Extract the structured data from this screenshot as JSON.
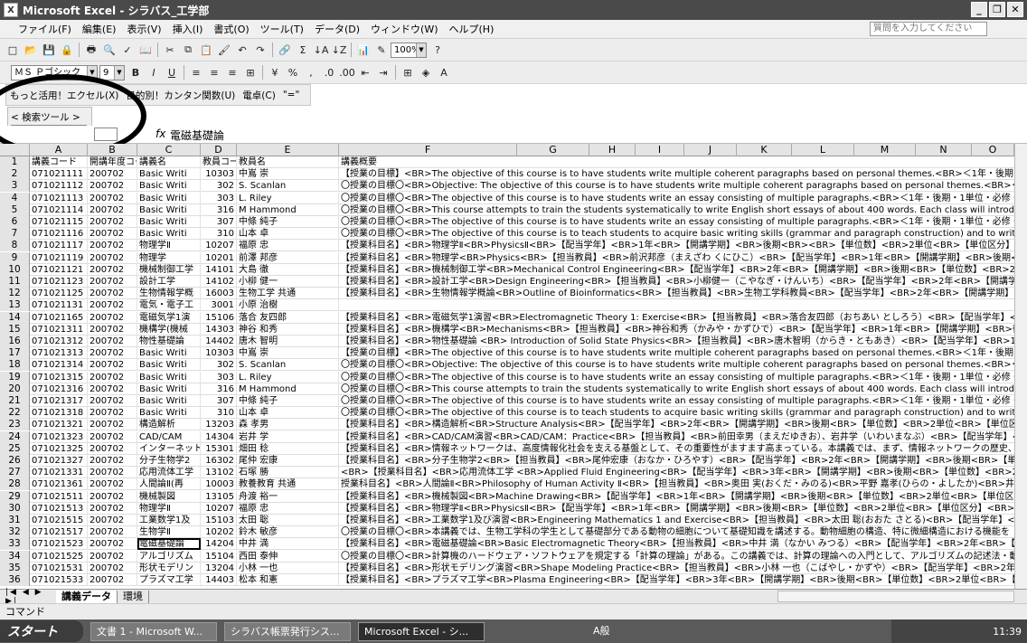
{
  "window": {
    "title": "Microsoft Excel - シラバス_工学部"
  },
  "menu": {
    "items": [
      "ファイル(F)",
      "編集(E)",
      "表示(V)",
      "挿入(I)",
      "書式(O)",
      "ツール(T)",
      "データ(D)",
      "ウィンドウ(W)",
      "ヘルプ(H)"
    ],
    "help_placeholder": "質問を入力してください"
  },
  "toolbar": {
    "zoom": "100%",
    "font": "ＭＳ Ｐゴシック",
    "size": "9"
  },
  "toolbar3": {
    "items": [
      "もっと活用！エクセル(X)",
      "目的別！カンタン関数(U)",
      "電卓(C)",
      "\"=\""
    ]
  },
  "search": {
    "label": "< 検索ツール >",
    "button": "検索"
  },
  "formula": {
    "fx": "fx",
    "value": "電磁基礎論"
  },
  "columns": [
    "A",
    "B",
    "C",
    "D",
    "E",
    "F",
    "G",
    "H",
    "I",
    "J",
    "K",
    "L",
    "M",
    "N",
    "O"
  ],
  "rows": [
    {
      "n": "1",
      "a": "講義コード",
      "b": "開講年度コード",
      "c": "講義名",
      "d": "教員コード",
      "e": "教員名",
      "f": "講義概要"
    },
    {
      "n": "2",
      "a": "071021111",
      "b": "200702",
      "c": "Basic Writi",
      "d": "10303",
      "e": "中嶌 崇",
      "f": "【授業の目標】<BR>The objective of this course is to have students write multiple coherent paragraphs based on personal themes.<BR>＜1年・後期・1単位・必修・機"
    },
    {
      "n": "3",
      "a": "071021112",
      "b": "200702",
      "c": "Basic Writi",
      "d": "302",
      "e": "S. Scanlan",
      "f": "〇授業の目標〇<BR>Objective: The objective of this course is to have students write multiple coherent paragraphs based on personal themes.<BR>＜1年・後期・1単位・必修・機"
    },
    {
      "n": "4",
      "a": "071021113",
      "b": "200702",
      "c": "Basic Writi",
      "d": "303",
      "e": "L. Riley",
      "f": "〇授業の目標〇<BR>The objective of this course is to have students write an essay consisting of multiple paragraphs.<BR>＜1年・後期・1単位・必修・機械システム"
    },
    {
      "n": "5",
      "a": "071021114",
      "b": "200702",
      "c": "Basic Writi",
      "d": "316",
      "e": "M Hammond",
      "f": "〇授業の目標〇<BR>This course attempts to train the students systematically to write English short essays of about 400 words. Each class will introduce a new te"
    },
    {
      "n": "6",
      "a": "071021115",
      "b": "200702",
      "c": "Basic Writi",
      "d": "307",
      "e": "中條 純子",
      "f": "〇授業の目標〇<BR>The objective of this course is to have students write an essay consisting of multiple paragraphs.<BR>＜1年・後期・1単位・必修・機械システム"
    },
    {
      "n": "7",
      "a": "071021116",
      "b": "200702",
      "c": "Basic Writi",
      "d": "310",
      "e": "山本 卓",
      "f": "〇授業の目標〇<BR>The objective of this course is to teach students to acquire basic writing skills (grammar and paragraph construction) and to write a multiple p"
    },
    {
      "n": "8",
      "a": "071021117",
      "b": "200702",
      "c": "物理学Ⅱ",
      "d": "10207",
      "e": "福原 忠",
      "f": "【授業科目名】<BR>物理学Ⅱ<BR>PhysicsⅡ<BR>【配当学年】<BR>1年<BR>【開講学期】<BR>後期<BR><BR>【単位数】<BR>2単位<BR>【単位区分】<"
    },
    {
      "n": "9",
      "a": "071021119",
      "b": "200702",
      "c": "物理学",
      "d": "10201",
      "e": "前澤 邦彦",
      "f": "【授業科目名】<BR>物理学<BR>Physics<BR>【担当教員】<BR>前沢邦彦（まえざわ くにひこ）<BR>【配当学年】<BR>1年<BR>【開講学期】<BR>後期<BR>【単位数】<BR"
    },
    {
      "n": "10",
      "a": "071021121",
      "b": "200702",
      "c": "機械制御工学",
      "d": "14101",
      "e": "大島 徹",
      "f": "【授業科目名】<BR>機械制御工学<BR>Mechanical Control Engineering<BR>【配当学年】<BR>2年<BR>【開講学期】<BR>後期<BR>【単位数】<BR>2単位<BR>【単位区"
    },
    {
      "n": "11",
      "a": "071021123",
      "b": "200702",
      "c": "設計工学",
      "d": "14102",
      "e": "小柳 健一",
      "f": "【授業科目名】<BR>設計工学<BR>Design Engineering<BR>【担当教員】<BR>小柳健一（こやなぎ・けんいち）<BR>【配当学年】<BR>2年<BR>【開講学期】<BR>後"
    },
    {
      "n": "12",
      "a": "071021125",
      "b": "200702",
      "c": "生物情報学概",
      "d": "16003",
      "e": "生物工学 共通",
      "f": "【授業科目名】<BR>生物情報学概論<BR>Outline of Bioinformatics<BR>【担当教員】<BR>生物工学科教員<BR>【配当学年】<BR>2年<BR>【開講学期】<BR>後"
    },
    {
      "n": "13",
      "a": "071021131",
      "b": "200702",
      "c": "電気・電子工",
      "d": "3001",
      "e": "小原 治樹",
      "f": ""
    },
    {
      "n": "14",
      "a": "071021165",
      "b": "200702",
      "c": "電磁気学1演",
      "d": "15106",
      "e": "落合 友四郎",
      "f": "【授業科目名】<BR>電磁気学1演習<BR>Electromagnetic Theory 1: Exercise<BR>【担当教員】<BR>落合友四郎（おちあい としろう）<BR>【配当学年】<BR>2年<BR>【"
    },
    {
      "n": "15",
      "a": "071021311",
      "b": "200702",
      "c": "機構学(機械",
      "d": "14303",
      "e": "神谷 和秀",
      "f": "【授業科目名】<BR>機構学<BR>Mechanisms<BR>【担当教員】<BR>神谷和秀（かみや・かずひで）<BR>【配当学年】<BR>1年<BR>【開講学期】<BR>後期<BR>【単位数】"
    },
    {
      "n": "16",
      "a": "071021312",
      "b": "200702",
      "c": "物性基礎論",
      "d": "14402",
      "e": "唐木 智明",
      "f": "【授業科目名】<BR>物性基礎論 <BR> Introduction of Solid State Physics<BR>【担当教員】<BR>唐木智明（からき・ともあき）<BR>【配当学年】<BR>1年<BR>"
    },
    {
      "n": "17",
      "a": "071021313",
      "b": "200702",
      "c": "Basic Writi",
      "d": "10303",
      "e": "中嶌 崇",
      "f": "【授業の目標】<BR>The objective of this course is to have students write multiple coherent paragraphs based on personal themes.<BR>＜1年・後期・1単位・必修・機"
    },
    {
      "n": "18",
      "a": "071021314",
      "b": "200702",
      "c": "Basic Writi",
      "d": "302",
      "e": "S. Scanlan",
      "f": "〇授業の目標〇<BR>Objective: The objective of this course is to have students write multiple coherent paragraphs based on personal themes.<BR>＜1年・後期・1単位・必修・機"
    },
    {
      "n": "19",
      "a": "071021315",
      "b": "200702",
      "c": "Basic Writi",
      "d": "303",
      "e": "L. Riley",
      "f": "〇授業の目標〇<BR>The objective of this course is to have students write an essay consisting of multiple paragraphs.<BR>＜1年・後期・1単位・必修・機械システム"
    },
    {
      "n": "20",
      "a": "071021316",
      "b": "200702",
      "c": "Basic Writi",
      "d": "316",
      "e": "M Hammond",
      "f": "〇授業の目標〇<BR>This course attempts to train the students systematically to write English short essays of about 400 words. Each class will introduce a new te"
    },
    {
      "n": "21",
      "a": "071021317",
      "b": "200702",
      "c": "Basic Writi",
      "d": "307",
      "e": "中條 純子",
      "f": "〇授業の目標〇<BR>The objective of this course is to have students write an essay consisting of multiple paragraphs.<BR>＜1年・後期・1単位・必修・機械システム"
    },
    {
      "n": "22",
      "a": "071021318",
      "b": "200702",
      "c": "Basic Writi",
      "d": "310",
      "e": "山本 卓",
      "f": "〇授業の目標〇<BR>The objective of this course is to teach students to acquire basic writing skills (grammar and paragraph construction) and to write a multiple p"
    },
    {
      "n": "23",
      "a": "071021321",
      "b": "200702",
      "c": "構造解析",
      "d": "13203",
      "e": "森 孝男",
      "f": "【授業科目名】<BR>構造解析<BR>Structure Analysis<BR>【配当学年】<BR>2年<BR>【開講学期】<BR>後期<BR>【単位数】<BR>2単位<BR>【単位区分】<BR>"
    },
    {
      "n": "24",
      "a": "071021323",
      "b": "200702",
      "c": "CAD/CAM",
      "d": "14304",
      "e": "岩井 学",
      "f": "【授業科目名】<BR>CAD/CAM演習<BR>CAD/CAM：Practice<BR>【担当教員】<BR>前田幸男（まえだゆきお）、岩井学（いわいまなぶ）<BR>【配当学年】<BR>2年"
    },
    {
      "n": "25",
      "a": "071021325",
      "b": "200702",
      "c": "インターネット",
      "d": "15301",
      "e": "畑田 稔",
      "f": "【授業科目名】<BR>情報ネットワークは、高度情報化社会を支える基盤として、その重要性がますます高まっている。本講義では、まず、情報ネットワークの歴史、基本概"
    },
    {
      "n": "26",
      "a": "071021327",
      "b": "200702",
      "c": "分子生物学2",
      "d": "16302",
      "e": "尾仲 宏康",
      "f": "【授業科目名】<BR>分子生物学2<BR>【担当教員】<BR>尾仲宏康（おなか・ひろやす）<BR>【配当学年】<BR>2年<BR>【開講学期】<BR>後期<BR>【単位数】<BR>2単位<BR>"
    },
    {
      "n": "27",
      "a": "071021331",
      "b": "200702",
      "c": "応用流体工学",
      "d": "13102",
      "e": "石塚 勝",
      "f": "<BR>【授業科目名】<BR>応用流体工学  <BR>Applied Fluid Engineering<BR>【配当学年】<BR>3年<BR>【開講学期】<BR>後期<BR>【単位数】<BR>2単位<BR>"
    },
    {
      "n": "28",
      "a": "071021361",
      "b": "200702",
      "c": "人間論Ⅱ(再",
      "d": "10003",
      "e": "教養教育 共通",
      "f": "授業科目名】<BR>人間論Ⅱ<BR>Philosophy of Human Activity Ⅱ<BR>【担当教員】<BR>奥田 実(おくだ・みのる)<BR>平野 嘉孝(ひらの・よしたか)<BR>井"
    },
    {
      "n": "29",
      "a": "071021511",
      "b": "200702",
      "c": "機械製図",
      "d": "13105",
      "e": "舟渡 裕一",
      "f": "【授業科目名】<BR>機械製図<BR>Machine Drawing<BR>【配当学年】<BR>1年<BR>【開講学期】<BR>後期<BR>【単位数】<BR>2単位<BR>【単位区分】<BR>"
    },
    {
      "n": "30",
      "a": "071021513",
      "b": "200702",
      "c": "物理学Ⅱ",
      "d": "10207",
      "e": "福原 忠",
      "f": "【授業科目名】<BR>物理学Ⅱ<BR>PhysicsⅡ<BR>【配当学年】<BR>1年<BR>【開講学期】<BR>後期<BR>【単位数】<BR>2単位<BR>【単位区分】<BR>"
    },
    {
      "n": "31",
      "a": "071021515",
      "b": "200702",
      "c": "工業数学1及",
      "d": "15103",
      "e": "太田 聡",
      "f": "【授業科目名】<BR>工業数学1及び演習<BR>Engineering Mathematics 1 and Exercise<BR>【担当教員】<BR>太田 聡(おおた さとる)<BR>【配当学年】<BR>1年<BR>"
    },
    {
      "n": "32",
      "a": "071021517",
      "b": "200702",
      "c": "生物学Ⅱ",
      "d": "10202",
      "e": "鈴木 敏彦",
      "f": "〇授業の目標〇<BR>本講義では、生物工学科の学生として基礎部分である動物の細胞について基礎知識を講述する。動物細胞の構造、特に微細構造における機能を"
    },
    {
      "n": "33",
      "a": "071021523",
      "b": "200702",
      "c": "電磁基礎論",
      "d": "14204",
      "e": "中井 満",
      "f": "【授業科目名】<BR>電磁基礎論<BR>Basic Electromagnetic Theory<BR>【担当教員】<BR>中井 満（なかい みつる）<BR>【配当学年】<BR>2年<BR>【開講時期】<BR>"
    },
    {
      "n": "34",
      "a": "071021525",
      "b": "200702",
      "c": "アルゴリズム",
      "d": "15104",
      "e": "西田 泰伸",
      "f": "〇授業の目標〇<BR>計算機のハードウェア・ソフトウェアを規定する「計算の理論」がある。この講義では、計算の理論への入門として、アルゴリズムの記述法・動作・計"
    },
    {
      "n": "35",
      "a": "071021531",
      "b": "200702",
      "c": "形状モデリン",
      "d": "13204",
      "e": "小林 一也",
      "f": "【授業科目名】<BR>形状モデリング演習<BR>Shape Modeling Practice<BR>【担当教員】<BR>小林 一也（こばやし・かずや）<BR>【配当学年】<BR>2年 及び"
    },
    {
      "n": "36",
      "a": "071021533",
      "b": "200702",
      "c": "プラズマ工学",
      "d": "14403",
      "e": "松本 和憲",
      "f": "【授業科目名】<BR>プラズマ工学<BR>Plasma Engineering<BR>【配当学年】<BR>3年<BR>【開講学期】<BR>後期<BR>【単位数】<BR>2単位<BR>【単位区分】<BR>"
    }
  ],
  "selected_row": "33",
  "sheets": {
    "tabs": [
      "講義データ",
      "環境"
    ]
  },
  "status": {
    "text": "コマンド"
  },
  "taskbar": {
    "start": "スタート",
    "tasks": [
      "文書 1 - Microsoft W...",
      "シラバス帳票発行シス...",
      "Microsoft Excel - シ..."
    ],
    "ime": "A般",
    "time": "11:39"
  }
}
